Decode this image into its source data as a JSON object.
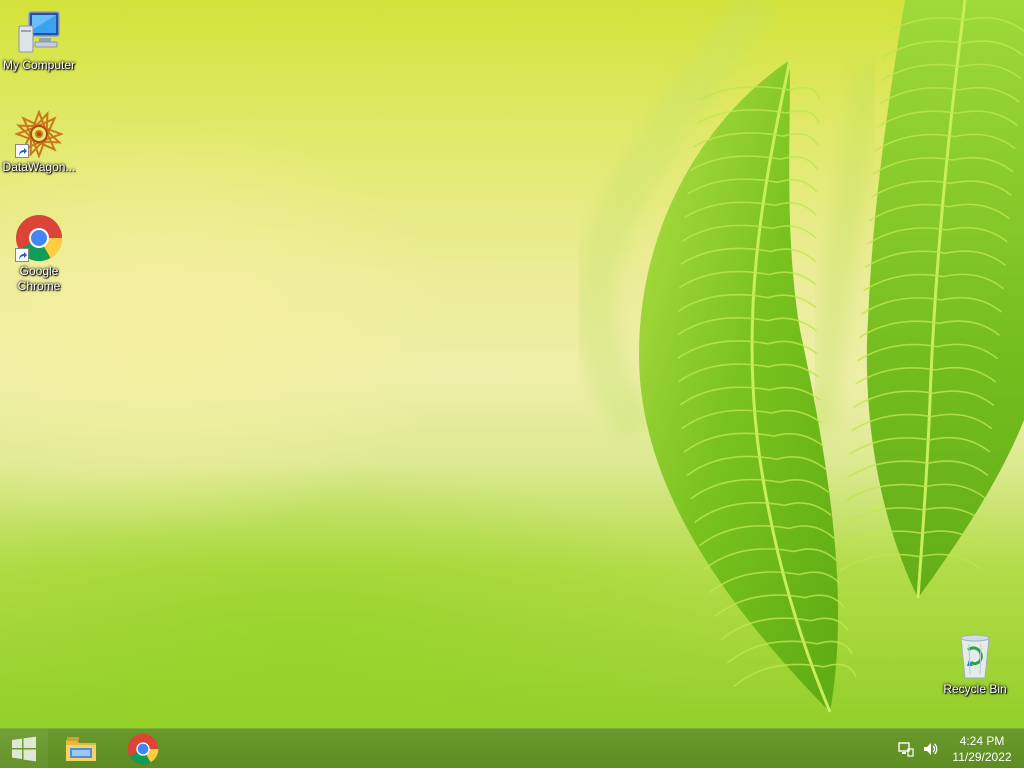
{
  "desktop": {
    "icons": [
      {
        "label": "My Computer",
        "icon": "my-computer-icon"
      },
      {
        "label": "DataWagon...",
        "icon": "datawagon-icon",
        "shortcut": true
      },
      {
        "label": "Google\nChrome",
        "icon": "chrome-icon",
        "shortcut": true
      },
      {
        "label": "Recycle Bin",
        "icon": "recycle-bin-icon"
      }
    ],
    "wallpaper": {
      "base_color": "#e8eb95",
      "leaf_color": "#7cc521",
      "leaf_vein_color": "#c9ec4a"
    }
  },
  "taskbar": {
    "color": "#5f8f25",
    "start_button": {
      "icon": "windows-logo-icon"
    },
    "pinned": [
      {
        "name": "File Explorer",
        "icon": "folder-icon"
      },
      {
        "name": "Google Chrome",
        "icon": "chrome-icon"
      }
    ],
    "tray": {
      "icons": [
        "network-icon",
        "volume-icon"
      ],
      "time": "4:24 PM",
      "date": "11/29/2022"
    }
  }
}
